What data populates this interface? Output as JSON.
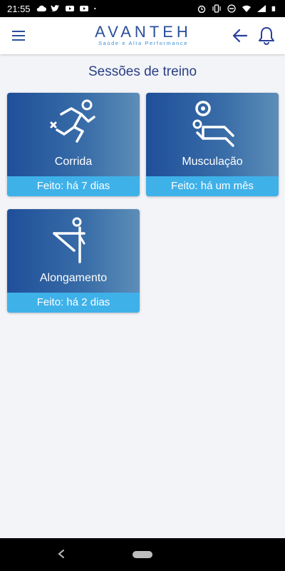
{
  "status_bar": {
    "time": "21:55",
    "left_icons": [
      "cloud-icon",
      "twitter-icon",
      "youtube-icon",
      "youtube-icon",
      "dot-icon"
    ],
    "right_icons": [
      "alarm-icon",
      "vibrate-icon",
      "dnd-icon",
      "wifi-icon",
      "signal-icon",
      "battery-icon"
    ]
  },
  "app_bar": {
    "logo_text": "AVANTEH",
    "logo_tagline": "Saúde e Alta Performance",
    "menu_icon": "menu-icon",
    "back_icon": "arrow-left-icon",
    "notification_icon": "bell-icon"
  },
  "page": {
    "title": "Sessões de treino"
  },
  "sessions": [
    {
      "label": "Corrida",
      "status": "Feito: há 7 dias",
      "icon": "running-icon"
    },
    {
      "label": "Musculação",
      "status": "Feito: há um mês",
      "icon": "weightlifting-icon"
    },
    {
      "label": "Alongamento",
      "status": "Feito: há 2 dias",
      "icon": "stretching-icon"
    }
  ],
  "colors": {
    "accent": "#2a3f84",
    "card_gradient_start": "#1f4f9a",
    "card_gradient_end": "#5d8eb8",
    "card_footer": "#3fb1e9",
    "background": "#f3f4f8"
  }
}
